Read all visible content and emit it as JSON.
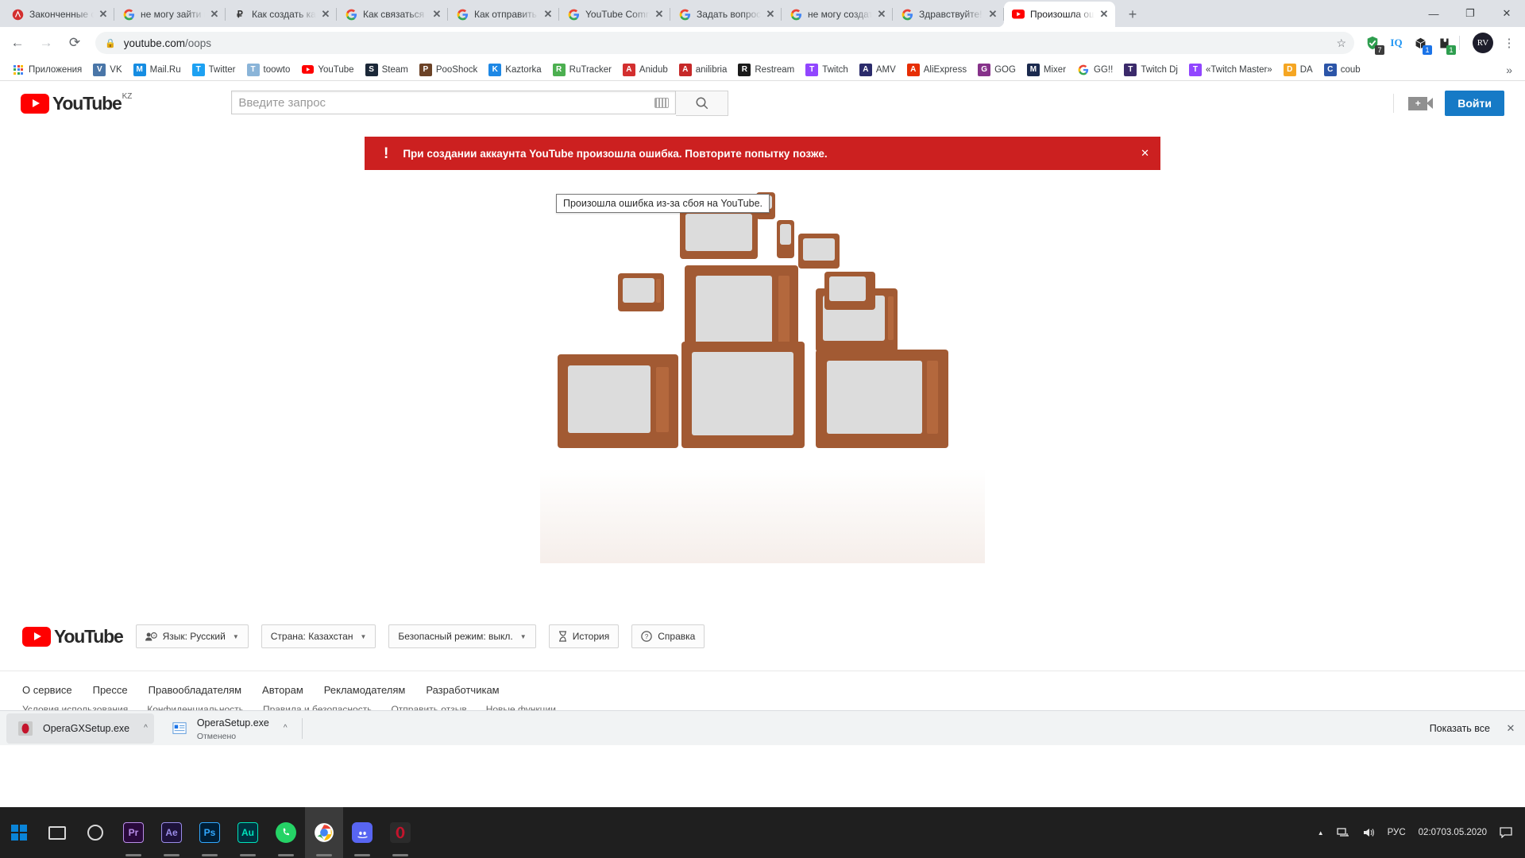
{
  "browser": {
    "tabs": [
      {
        "title": "Законченные сери",
        "favicon": "anidub-icon",
        "color": "#d32f2f"
      },
      {
        "title": "не могу зайти в св",
        "favicon": "google-icon",
        "color": "#4285f4"
      },
      {
        "title": "Как создать канал",
        "favicon": "p-icon",
        "color": "#333333"
      },
      {
        "title": "Как связаться со сп",
        "favicon": "google-icon",
        "color": "#4285f4"
      },
      {
        "title": "Как отправить отзы",
        "favicon": "google-icon",
        "color": "#4285f4"
      },
      {
        "title": "YouTube Communit",
        "favicon": "google-icon",
        "color": "#4285f4"
      },
      {
        "title": "Задать вопрос - Yo",
        "favicon": "google-icon",
        "color": "#4285f4"
      },
      {
        "title": "не могу создать ка",
        "favicon": "google-icon",
        "color": "#4285f4"
      },
      {
        "title": "Здравствуйте! Я уд",
        "favicon": "google-icon",
        "color": "#4285f4"
      },
      {
        "title": "Произошла ошибк",
        "favicon": "youtube-icon",
        "color": "#ff0000",
        "active": true
      }
    ],
    "new_tab_label": "+",
    "window_controls": {
      "minimize": "—",
      "maximize": "❐",
      "close": "✕"
    },
    "nav": {
      "back": "←",
      "forward": "→",
      "reload": "⟳"
    },
    "omnibox": {
      "lock": "🔒",
      "domain": "youtube.com",
      "path": "/oops",
      "star": "☆"
    },
    "extensions": [
      {
        "name": "adblock-shield-icon",
        "badge": "7",
        "badge_color": "#3c3c3c",
        "color": "#2e9e4f"
      },
      {
        "name": "iq-icon",
        "badge": "",
        "badge_color": "",
        "color": "#2196f3"
      },
      {
        "name": "box-extension-icon",
        "badge": "1",
        "badge_color": "#1a73e8",
        "color": "#2b2b2b"
      },
      {
        "name": "puzzle-extension-icon",
        "badge": "1",
        "badge_color": "#2e9e4f",
        "color": "#2b2b2b"
      }
    ],
    "avatar_label": "RV",
    "menu_label": "⋮",
    "bookmarks": [
      {
        "label": "Приложения",
        "icon": "apps-grid-icon",
        "color": "#ffffff"
      },
      {
        "label": "VK",
        "icon": "vk-icon",
        "color": "#4a76a8"
      },
      {
        "label": "Mail.Ru",
        "icon": "mailru-icon",
        "color": "#168de2"
      },
      {
        "label": "Twitter",
        "icon": "twitter-icon",
        "color": "#1da1f2"
      },
      {
        "label": "toowto",
        "icon": "toowto-icon",
        "color": "#8ab4d8"
      },
      {
        "label": "YouTube",
        "icon": "youtube-icon",
        "color": "#ff0000"
      },
      {
        "label": "Steam",
        "icon": "steam-icon",
        "color": "#1b2838"
      },
      {
        "label": "PooShock",
        "icon": "pooshock-icon",
        "color": "#6b4226"
      },
      {
        "label": "Kaztorka",
        "icon": "kaztorka-icon",
        "color": "#1e88e5"
      },
      {
        "label": "RuTracker",
        "icon": "rutracker-icon",
        "color": "#4caf50"
      },
      {
        "label": "Anidub",
        "icon": "anidub-icon",
        "color": "#d32f2f"
      },
      {
        "label": "anilibria",
        "icon": "anilibria-icon",
        "color": "#c62828"
      },
      {
        "label": "Restream",
        "icon": "restream-icon",
        "color": "#1a1a1a"
      },
      {
        "label": "Twitch",
        "icon": "twitch-icon",
        "color": "#9146ff"
      },
      {
        "label": "AMV",
        "icon": "amv-icon",
        "color": "#2b2b6b"
      },
      {
        "label": "AliExpress",
        "icon": "aliexpress-icon",
        "color": "#e62e04"
      },
      {
        "label": "GOG",
        "icon": "gog-icon",
        "color": "#86328a"
      },
      {
        "label": "Mixer",
        "icon": "mixer-icon",
        "color": "#1b2a4e"
      },
      {
        "label": "GG!!",
        "icon": "google-icon",
        "color": "#4285f4"
      },
      {
        "label": "Twitch Dj",
        "icon": "twitchdj-icon",
        "color": "#3b2a6b"
      },
      {
        "label": "«Twitch Master»",
        "icon": "twitch-icon",
        "color": "#9146ff"
      },
      {
        "label": "DA",
        "icon": "da-icon",
        "color": "#f5a623"
      },
      {
        "label": "coub",
        "icon": "coub-icon",
        "color": "#2c55a8"
      }
    ],
    "bookmarks_overflow": "»"
  },
  "youtube": {
    "logo_word": "YouTube",
    "logo_country": "KZ",
    "search": {
      "placeholder": "Введите запрос",
      "value": "",
      "keyboard_icon": "keyboard-icon",
      "search_icon": "⌕"
    },
    "upload_icon": "video-camera-plus-icon",
    "signin_label": "Войти",
    "banner": {
      "icon": "!",
      "message": "При создании аккаунта YouTube произошла ошибка. Повторите попытку позже.",
      "close": "✕",
      "color": "#cc2020"
    },
    "tooltip": "Произошла ошибка из-за сбоя на YouTube.",
    "footer": {
      "controls": [
        {
          "label": "Язык: Русский",
          "icon": "language-person-icon",
          "caret": "▼"
        },
        {
          "label": "Страна: Казахстан",
          "icon": "",
          "caret": "▼"
        },
        {
          "label": "Безопасный режим: выкл.",
          "icon": "",
          "caret": "▼"
        },
        {
          "label": "История",
          "icon": "hourglass-icon",
          "caret": ""
        },
        {
          "label": "Справка",
          "icon": "question-circle-icon",
          "caret": ""
        }
      ],
      "links_primary": [
        "О сервисе",
        "Прессе",
        "Правообладателям",
        "Авторам",
        "Рекламодателям",
        "Разработчикам"
      ],
      "links_secondary": [
        "Условия использования",
        "Конфиденциальность",
        "Правила и безопасность",
        "Отправить отзыв",
        "Новые функции"
      ]
    }
  },
  "downloads": {
    "items": [
      {
        "name": "OperaGXSetup.exe",
        "status": "",
        "icon": "opera-gx-icon",
        "caret": "^"
      },
      {
        "name": "OperaSetup.exe",
        "status": "Отменено",
        "icon": "file-icon",
        "caret": "^"
      }
    ],
    "show_all": "Показать все",
    "close": "✕"
  },
  "taskbar": {
    "start_icon": "windows-start-icon",
    "taskview_icon": "task-view-icon",
    "cortana_icon": "cortana-circle-icon",
    "apps": [
      {
        "name": "premiere-pro-icon",
        "label": "Pr",
        "color": "#2a0a3c",
        "text": "#b98ee8"
      },
      {
        "name": "after-effects-icon",
        "label": "Ae",
        "color": "#1d123a",
        "text": "#9a8ce8"
      },
      {
        "name": "photoshop-icon",
        "label": "Ps",
        "color": "#001e36",
        "text": "#31a8ff"
      },
      {
        "name": "audition-icon",
        "label": "Au",
        "color": "#00313e",
        "text": "#00e4bb"
      },
      {
        "name": "whatsapp-icon",
        "label": "",
        "color": "#25d366",
        "text": "#ffffff"
      },
      {
        "name": "chrome-icon",
        "label": "",
        "color": "#ffffff",
        "text": "#000000"
      },
      {
        "name": "discord-icon",
        "label": "",
        "color": "#5865f2",
        "text": "#ffffff"
      },
      {
        "name": "opera-gx-icon",
        "label": "",
        "color": "#c4142c",
        "text": "#ffffff"
      }
    ],
    "tray": {
      "chevron": "▲",
      "network_icon": "network-icon",
      "volume_icon": "volume-icon",
      "language": "РУС",
      "time": "02:07",
      "date": "03.05.2020",
      "notifications_icon": "notification-icon"
    }
  }
}
